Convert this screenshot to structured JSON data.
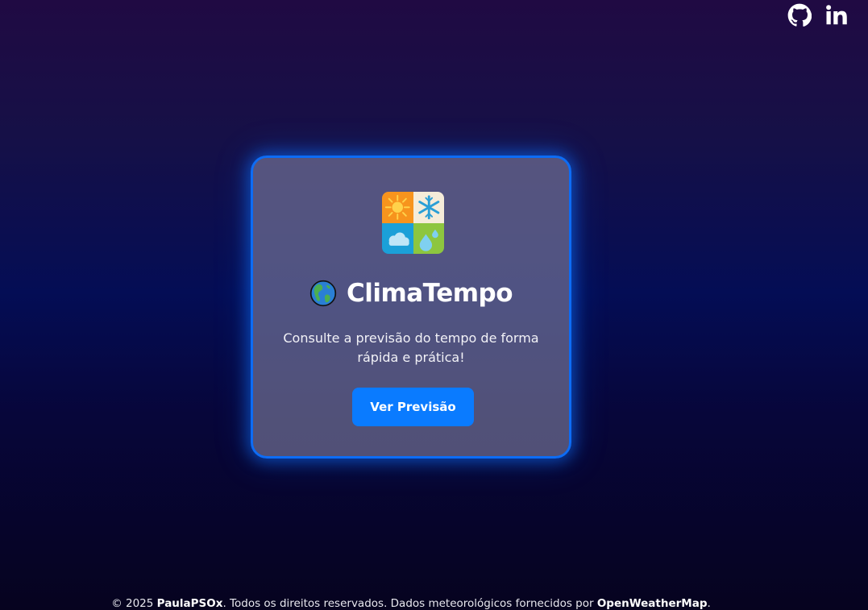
{
  "social": {
    "github": {
      "icon": "github-icon",
      "label": "GitHub"
    },
    "linkedin": {
      "icon": "linkedin-icon",
      "label": "in"
    }
  },
  "card": {
    "logo_icon": "weather-seasons-icon",
    "globe_icon": "globe-americas-icon",
    "title": "ClimaTempo",
    "subtitle": "Consulte a previsão do tempo de forma rápida e prática!",
    "button_label": "Ver Previsão"
  },
  "footer": {
    "copyright": "© 2025",
    "author": "PaulaPSOx",
    "rights_text": ". Todos os direitos reservados. Dados meteorológicos fornecidos por",
    "data_provider": "OpenWeatherMap",
    "end": "."
  },
  "colors": {
    "accent": "#0a7bff",
    "card_border": "#0d6cf5",
    "background_top": "#200a43",
    "background_mid": "#040d55",
    "background_bottom": "#06031f"
  }
}
